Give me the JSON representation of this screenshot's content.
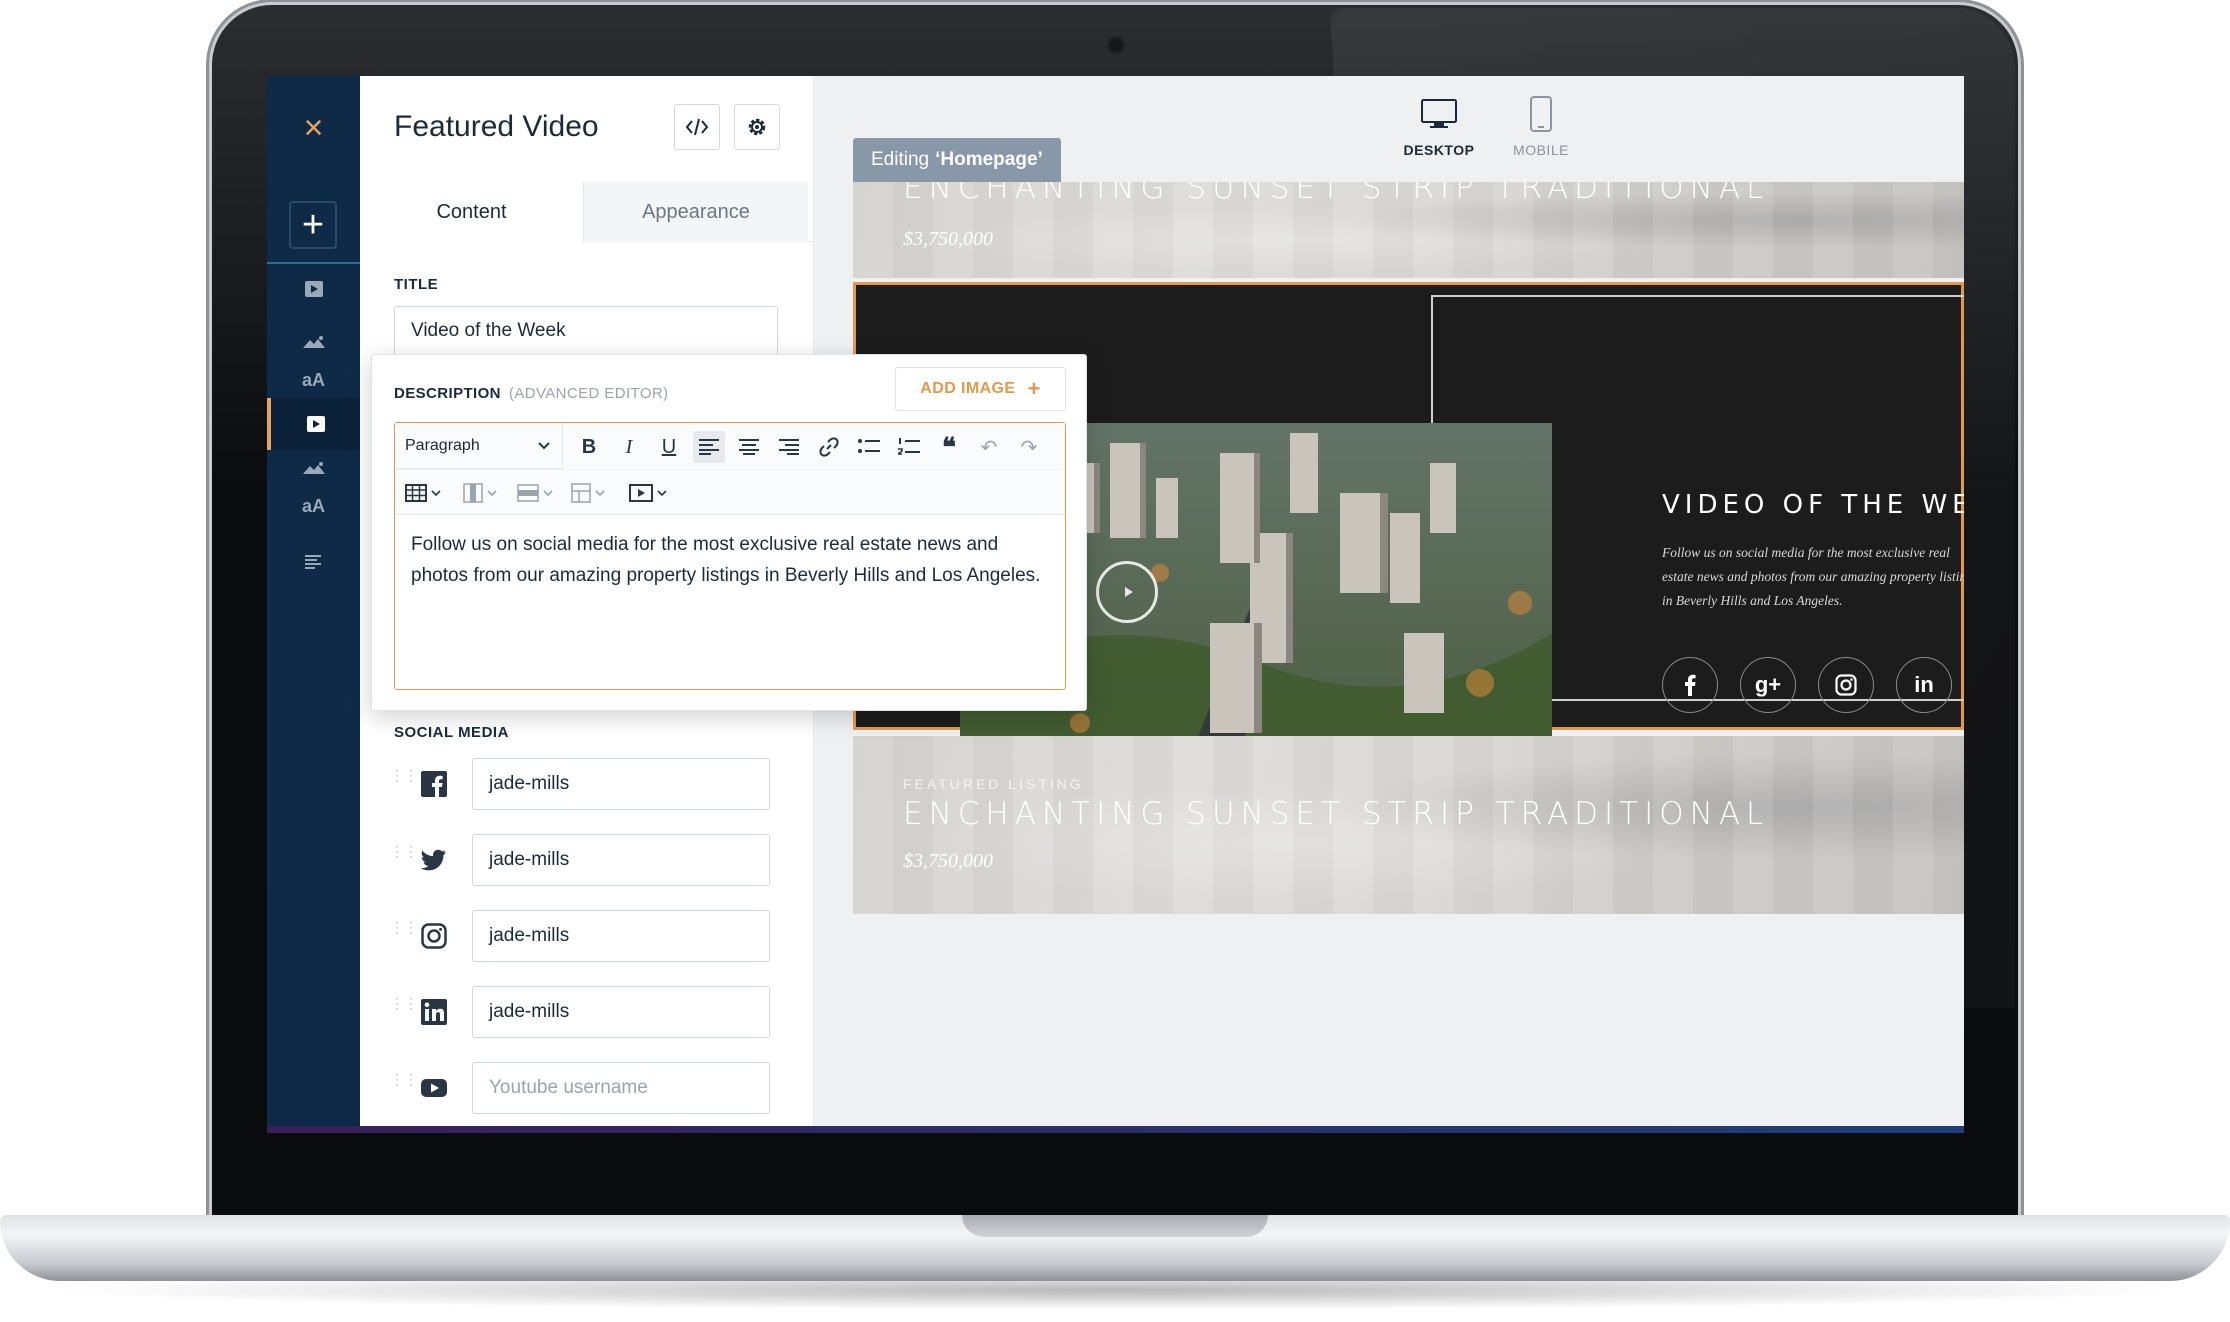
{
  "sidebar": {
    "close_glyph": "×",
    "add_glyph": "+",
    "typography_label": "aA",
    "items": [
      {
        "icon": "video-icon"
      },
      {
        "icon": "image-icon"
      },
      {
        "icon": "typography-icon"
      },
      {
        "icon": "video-icon",
        "selected": true
      },
      {
        "icon": "image-icon"
      },
      {
        "icon": "typography-icon"
      },
      {
        "icon": "text-align-icon"
      }
    ]
  },
  "panel": {
    "title": "Featured Video",
    "tabs": {
      "content": "Content",
      "appearance": "Appearance"
    },
    "title_field": {
      "label": "TITLE",
      "value": "Video of the Week"
    },
    "description": {
      "label": "DESCRIPTION",
      "sublabel": "(ADVANCED EDITOR)",
      "add_image_label": "ADD IMAGE",
      "add_image_glyph": "+",
      "format_select": "Paragraph",
      "body": "Follow us on social media for the most exclusive real estate news and photos from our amazing property listings in Beverly Hills and Los Angeles."
    },
    "social_media": {
      "label": "SOCIAL MEDIA",
      "rows": [
        {
          "icon": "facebook-icon",
          "value": "jade-mills",
          "placeholder": ""
        },
        {
          "icon": "twitter-icon",
          "value": "jade-mills",
          "placeholder": ""
        },
        {
          "icon": "instagram-icon",
          "value": "jade-mills",
          "placeholder": ""
        },
        {
          "icon": "linkedin-icon",
          "value": "jade-mills",
          "placeholder": ""
        },
        {
          "icon": "youtube-icon",
          "value": "",
          "placeholder": "Youtube username"
        }
      ]
    }
  },
  "preview": {
    "devices": {
      "desktop": "DESKTOP",
      "mobile": "MOBILE"
    },
    "editing_prefix": "Editing",
    "editing_page": "‘Homepage’",
    "top_listing": {
      "title": "ENCHANTING SUNSET STRIP TRADITIONAL",
      "price": "$3,750,000"
    },
    "video_section": {
      "title": "VIDEO OF THE WEE",
      "description": "Follow us on social media for the most exclusive real estate news and photos from our amazing property listings in Beverly Hills and Los Angeles.",
      "social_icons": [
        "facebook-icon",
        "google-plus-icon",
        "instagram-icon",
        "linkedin-icon"
      ],
      "google_plus_glyph": "g+",
      "linkedin_glyph": "in"
    },
    "bottom_listing": {
      "kicker": "FEATURED LISTING",
      "title": "ENCHANTING SUNSET STRIP TRADITIONAL",
      "price": "$3,750,000"
    }
  },
  "colors": {
    "accent": "#e09a4f",
    "sidebar": "#0e2a47",
    "video_bg": "#1c1c1c"
  }
}
